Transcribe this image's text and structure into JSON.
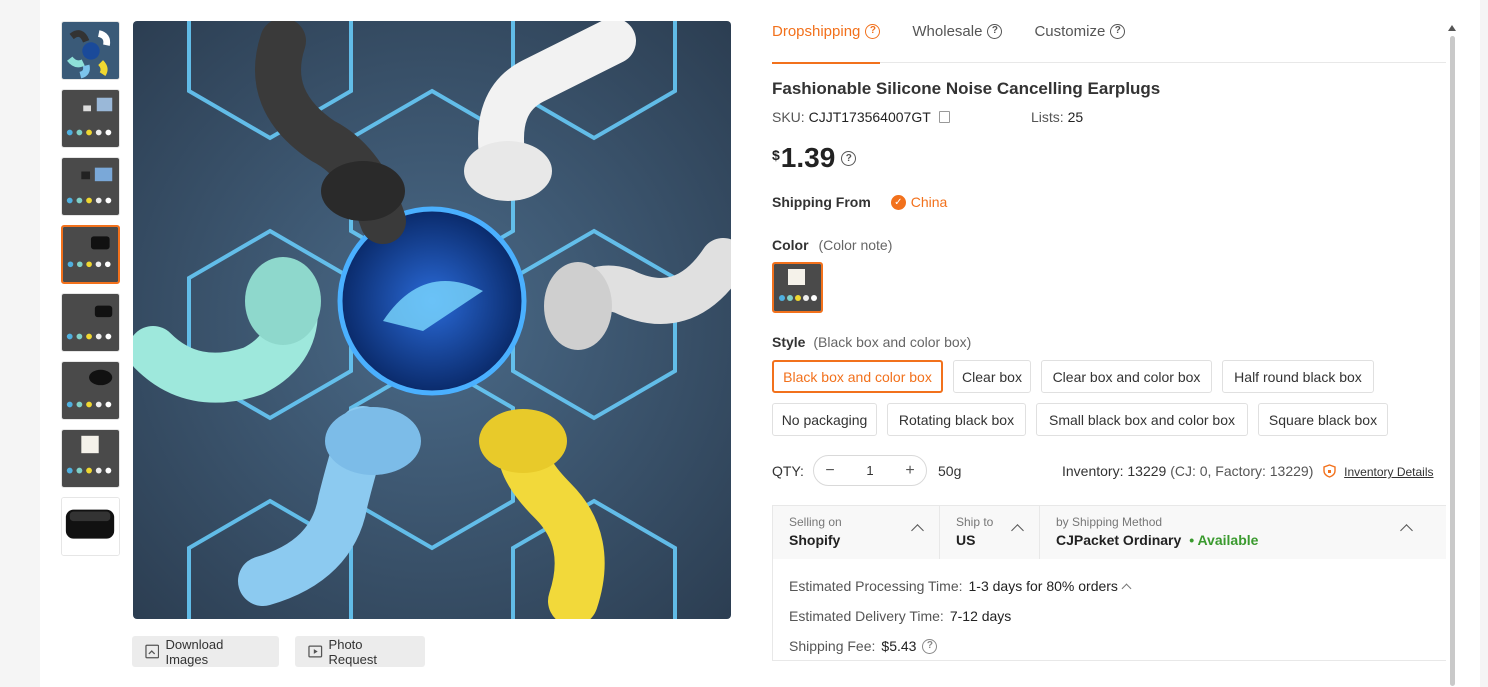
{
  "tabs": [
    {
      "label": "Dropshipping",
      "active": true
    },
    {
      "label": "Wholesale",
      "active": false
    },
    {
      "label": "Customize",
      "active": false
    }
  ],
  "product": {
    "title": "Fashionable Silicone Noise Cancelling Earplugs",
    "sku_label": "SKU:",
    "sku": "CJJT173564007GT",
    "lists_label": "Lists:",
    "lists": "25",
    "currency": "$",
    "price": "1.39"
  },
  "shipping_from": {
    "label": "Shipping From",
    "value": "China"
  },
  "color": {
    "label": "Color",
    "note": "(Color note)"
  },
  "style": {
    "label": "Style",
    "note": "(Black box and color box)",
    "options": [
      "Black box and color box",
      "Clear box",
      "Clear box and color box",
      "Half round black box",
      "No packaging",
      "Rotating black box",
      "Small black box and color box",
      "Square black box"
    ],
    "selected_index": 0
  },
  "qty": {
    "label": "QTY:",
    "minus": "−",
    "plus": "+",
    "value": "1",
    "weight": "50g",
    "inventory": "Inventory: 13229",
    "inventory_detail": "(CJ: 0, Factory: 13229)",
    "inventory_link": "Inventory Details"
  },
  "shipping": {
    "selling_on_label": "Selling on",
    "selling_on": "Shopify",
    "ship_to_label": "Ship to",
    "ship_to": "US",
    "method_label": "by Shipping Method",
    "method": "CJPacket Ordinary",
    "availability": "• Available",
    "processing_label": "Estimated Processing Time:",
    "processing": "1-3 days for 80% orders",
    "delivery_label": "Estimated Delivery Time:",
    "delivery": "7-12 days",
    "fee_label": "Shipping Fee:",
    "fee": "$5.43"
  },
  "image_buttons": {
    "download": "Download Images",
    "photo_request": "Photo Request"
  },
  "colors": {
    "accent": "#f2711c",
    "available": "#3a9a2e"
  }
}
